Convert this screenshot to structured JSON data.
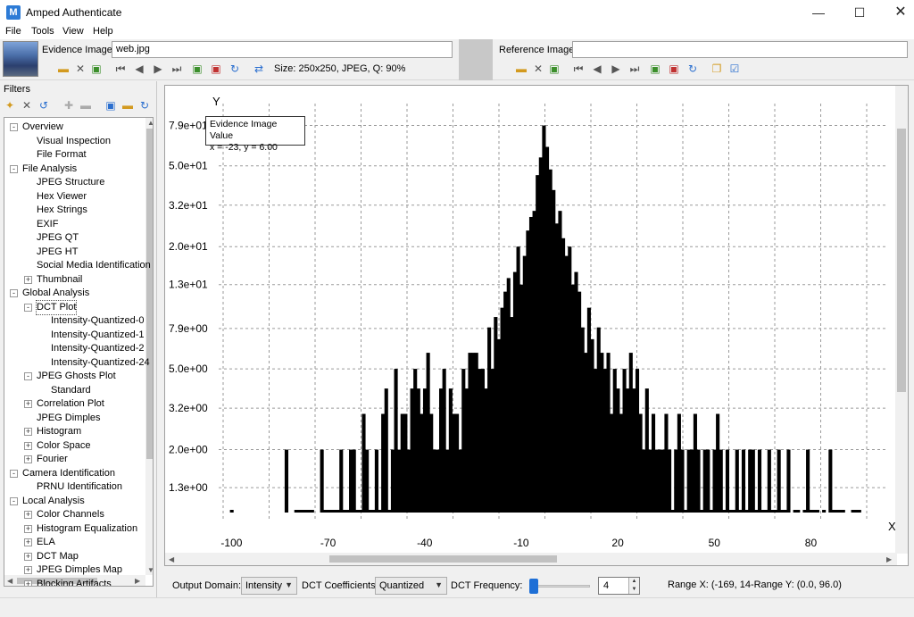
{
  "window": {
    "title": "Amped Authenticate",
    "app_icon": "M",
    "minimize": "—",
    "maximize": "☐",
    "close": "✕"
  },
  "menu": {
    "items": [
      "File",
      "Tools",
      "View",
      "Help"
    ]
  },
  "evidence": {
    "label": "Evidence Image:",
    "filename": "web.jpg",
    "size_info": "Size: 250x250, JPEG, Q: 90%"
  },
  "reference": {
    "label": "Reference Image:",
    "filename": ""
  },
  "filters": {
    "title": "Filters",
    "tree": [
      {
        "label": "Overview",
        "level": 0,
        "expander": "-"
      },
      {
        "label": "Visual Inspection",
        "level": 1
      },
      {
        "label": "File Format",
        "level": 1
      },
      {
        "label": "File Analysis",
        "level": 0,
        "expander": "-"
      },
      {
        "label": "JPEG Structure",
        "level": 1
      },
      {
        "label": "Hex Viewer",
        "level": 1
      },
      {
        "label": "Hex Strings",
        "level": 1
      },
      {
        "label": "EXIF",
        "level": 1
      },
      {
        "label": "JPEG QT",
        "level": 1
      },
      {
        "label": "JPEG HT",
        "level": 1
      },
      {
        "label": "Social Media Identification",
        "level": 1
      },
      {
        "label": "Thumbnail",
        "level": 1,
        "expander": "+"
      },
      {
        "label": "Global Analysis",
        "level": 0,
        "expander": "-"
      },
      {
        "label": "DCT Plot",
        "level": 1,
        "expander": "-",
        "selected": true
      },
      {
        "label": "Intensity-Quantized-0",
        "level": 2
      },
      {
        "label": "Intensity-Quantized-1",
        "level": 2
      },
      {
        "label": "Intensity-Quantized-2",
        "level": 2
      },
      {
        "label": "Intensity-Quantized-24",
        "level": 2
      },
      {
        "label": "JPEG Ghosts Plot",
        "level": 1,
        "expander": "-"
      },
      {
        "label": "Standard",
        "level": 2
      },
      {
        "label": "Correlation Plot",
        "level": 1,
        "expander": "+"
      },
      {
        "label": "JPEG Dimples",
        "level": 1
      },
      {
        "label": "Histogram",
        "level": 1,
        "expander": "+"
      },
      {
        "label": "Color Space",
        "level": 1,
        "expander": "+"
      },
      {
        "label": "Fourier",
        "level": 1,
        "expander": "+"
      },
      {
        "label": "Camera Identification",
        "level": 0,
        "expander": "-"
      },
      {
        "label": "PRNU Identification",
        "level": 1
      },
      {
        "label": "Local Analysis",
        "level": 0,
        "expander": "-"
      },
      {
        "label": "Color Channels",
        "level": 1,
        "expander": "+"
      },
      {
        "label": "Histogram Equalization",
        "level": 1,
        "expander": "+"
      },
      {
        "label": "ELA",
        "level": 1,
        "expander": "+"
      },
      {
        "label": "DCT Map",
        "level": 1,
        "expander": "+"
      },
      {
        "label": "JPEG Dimples Map",
        "level": 1,
        "expander": "+"
      },
      {
        "label": "Blocking Artifacts",
        "level": 1,
        "expander": "+"
      }
    ]
  },
  "tooltip": {
    "title": "Evidence Image Value",
    "value": "x = -23, y = 6.00"
  },
  "chart_data": {
    "type": "bar",
    "title": "",
    "xlabel": "X",
    "ylabel": "Y",
    "x_ticks": [
      "-100",
      "-70",
      "-40",
      "-10",
      "20",
      "50",
      "80"
    ],
    "x_tick_values": [
      -100,
      -70,
      -40,
      -10,
      20,
      50,
      80
    ],
    "y_ticks": [
      "7.9e+01",
      "5.0e+01",
      "3.2e+01",
      "2.0e+01",
      "1.3e+01",
      "7.9e+00",
      "5.0e+00",
      "3.2e+00",
      "2.0e+00",
      "1.3e+00"
    ],
    "y_tick_values": [
      79,
      50,
      32,
      20,
      13,
      7.9,
      5.0,
      3.2,
      2.0,
      1.3
    ],
    "y_scale": "log",
    "xlim": [
      -104,
      104
    ],
    "grid": true,
    "x": [
      -100,
      -83,
      -80,
      -79,
      -78,
      -77,
      -76,
      -75,
      -72,
      -71,
      -70,
      -69,
      -68,
      -67,
      -66,
      -65,
      -64,
      -63,
      -62,
      -61,
      -60,
      -59,
      -58,
      -57,
      -56,
      -55,
      -54,
      -53,
      -52,
      -51,
      -50,
      -49,
      -48,
      -47,
      -46,
      -45,
      -44,
      -43,
      -42,
      -41,
      -40,
      -39,
      -38,
      -37,
      -36,
      -35,
      -34,
      -33,
      -32,
      -31,
      -30,
      -29,
      -28,
      -27,
      -26,
      -25,
      -24,
      -23,
      -22,
      -21,
      -20,
      -19,
      -18,
      -17,
      -16,
      -15,
      -14,
      -13,
      -12,
      -11,
      -10,
      -9,
      -8,
      -7,
      -6,
      -5,
      -4,
      -3,
      -2,
      -1,
      0,
      1,
      2,
      3,
      4,
      5,
      6,
      7,
      8,
      9,
      10,
      11,
      12,
      13,
      14,
      15,
      16,
      17,
      18,
      19,
      20,
      21,
      22,
      23,
      24,
      25,
      26,
      27,
      28,
      29,
      30,
      31,
      32,
      33,
      34,
      35,
      36,
      37,
      38,
      39,
      40,
      41,
      42,
      43,
      44,
      45,
      46,
      47,
      48,
      49,
      50,
      51,
      52,
      53,
      54,
      55,
      56,
      57,
      58,
      59,
      60,
      61,
      62,
      63,
      64,
      65,
      66,
      67,
      68,
      69,
      70,
      71,
      72,
      73,
      75,
      76,
      78,
      79,
      80,
      81,
      82,
      84,
      86,
      87,
      88,
      89,
      90,
      93,
      94,
      95,
      97
    ],
    "values": [
      1,
      2,
      1,
      1,
      1,
      1,
      1,
      1,
      2,
      1,
      1,
      1,
      1,
      1,
      2,
      1,
      1,
      2,
      2,
      1,
      1,
      3,
      2,
      1,
      1,
      2,
      1,
      3,
      4,
      1,
      2,
      5,
      2,
      3,
      3,
      2,
      4,
      5,
      4,
      3,
      4,
      6,
      3,
      2,
      2,
      4,
      5,
      2,
      4,
      3,
      3,
      2,
      5,
      4,
      6,
      6,
      6,
      5,
      5,
      4,
      8,
      5,
      9,
      7,
      10,
      12,
      14,
      9,
      15,
      20,
      13,
      18,
      24,
      28,
      30,
      45,
      55,
      79,
      62,
      48,
      38,
      26,
      30,
      22,
      18,
      20,
      13,
      15,
      12,
      8,
      6,
      10,
      7,
      5,
      8,
      6,
      5,
      6,
      3,
      5,
      4,
      3,
      5,
      4,
      6,
      4,
      5,
      3,
      2,
      4,
      2,
      3,
      2,
      2,
      2,
      3,
      2,
      1,
      2,
      3,
      2,
      1,
      2,
      2,
      3,
      2,
      1,
      2,
      2,
      1,
      2,
      3,
      2,
      1,
      2,
      1,
      1,
      2,
      1,
      2,
      1,
      2,
      2,
      1,
      2,
      1,
      1,
      2,
      1,
      1,
      2,
      1,
      1,
      2,
      1,
      1,
      1,
      2,
      1,
      1,
      1,
      1,
      2,
      1,
      1,
      1,
      1,
      1,
      1,
      1
    ]
  },
  "bottom": {
    "output_domain_label": "Output Domain:",
    "output_domain_value": "Intensity",
    "dct_coeff_label": "DCT Coefficients:",
    "dct_coeff_value": "Quantized",
    "dct_freq_label": "DCT Frequency:",
    "dct_freq_value": "4",
    "range_text": "Range X: (-169, 14-Range Y: (0.0, 96.0)"
  }
}
